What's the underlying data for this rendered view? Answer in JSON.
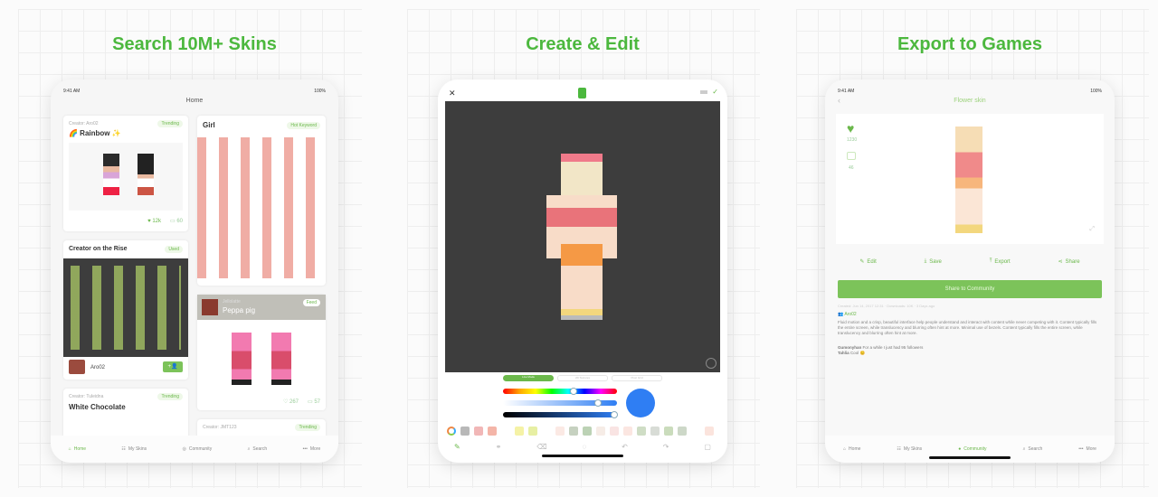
{
  "headlines": [
    "Search 10M+ Skins",
    "Create & Edit",
    "Export to Games"
  ],
  "colors": {
    "accent": "#6bb84b",
    "headline": "#4cb83e",
    "editor_bg": "#3d3d3d",
    "preview_blue": "#2f7ef3"
  },
  "panel1": {
    "status_time": "9:41 AM",
    "status_battery": "100%",
    "nav_title": "Home",
    "card_rainbow": {
      "creator": "Creator: Aro02",
      "badge": "Trending",
      "title": "🌈 Rainbow ✨",
      "likes": "12k",
      "comments": "60"
    },
    "card_girl": {
      "title": "Girl",
      "badge": "Hot Keyword"
    },
    "card_rise": {
      "title": "Creator on the Rise",
      "badge": "Used",
      "user": "Aro02",
      "follow_icon": "add-user-icon"
    },
    "card_peppa": {
      "creator": "Jellolatte",
      "badge": "Feed",
      "title": "Peppa pig",
      "likes": "267",
      "comments": "57"
    },
    "card_white": {
      "creator": "Creator: Tuleidna",
      "badge": "Trending",
      "title": "White Chocolate"
    },
    "card_jmt": {
      "creator": "Creator: JMT123",
      "badge": "Trending"
    },
    "tabs": [
      {
        "label": "Home",
        "icon": "home-icon",
        "active": true
      },
      {
        "label": "My Skins",
        "icon": "skins-icon"
      },
      {
        "label": "Community",
        "icon": "community-icon"
      },
      {
        "label": "Search",
        "icon": "search-icon"
      },
      {
        "label": "More",
        "icon": "more-icon"
      }
    ]
  },
  "panel2": {
    "close_icon": "✕",
    "confirm_icon": "✓",
    "mode_tabs": [
      "Live Mode",
      "2D Textures",
      "Pixel Grid"
    ],
    "hue_position": 0.62,
    "saturation_position": 0.83,
    "brightness_position": 0.98,
    "swatches": [
      "#b8b8b8",
      "#f1b7b7",
      "#f4b5a8",
      "#ffffff",
      "#f5f2a6",
      "#e7efa3",
      "#ffffff",
      "#fbe9e4",
      "#c6d1c0",
      "#bcd2b5",
      "#f6ece6",
      "#f9e4e3",
      "#fbe6e1",
      "#cfddc5",
      "#d8dcd6",
      "#cadcbc",
      "#cdd8c8",
      "#ffffff",
      "#fbe4dd"
    ],
    "tools": [
      "brush-icon",
      "link-icon",
      "eraser-icon",
      "bulb-icon",
      "undo-icon",
      "redo-icon",
      "crop-icon"
    ]
  },
  "panel3": {
    "status_time": "9:41 AM",
    "status_battery": "100%",
    "nav_title": "Flower skin",
    "likes": "1230",
    "comments": "46",
    "actions": [
      {
        "label": "Edit",
        "icon": "edit-icon"
      },
      {
        "label": "Save",
        "icon": "download-icon"
      },
      {
        "label": "Export",
        "icon": "export-icon"
      },
      {
        "label": "Share",
        "icon": "share-icon"
      }
    ],
    "share_button": "Share to Community",
    "meta": "Created: Jun 14, 2017 12:31 · Downloads: 10K · 3 Days ago",
    "author": "Aro02",
    "description": "Fluid motion and a crisp, beautiful interface help people understand and interact with content while never competing with it. Content typically fills the entire screen, while translucency and blurring often hint at more. Minimal use of bezels. Content typically fills the entire screen, while translucency and blurring often hint at more.",
    "comments_list": [
      {
        "user": "Gumonyhan",
        "text": "For a while I just had 95 followers"
      },
      {
        "user": "Tahlia",
        "text": "Cool 😊"
      }
    ],
    "tabs": [
      {
        "label": "Home",
        "icon": "home-icon"
      },
      {
        "label": "My Skins",
        "icon": "skins-icon"
      },
      {
        "label": "Community",
        "icon": "community-icon",
        "active": true
      },
      {
        "label": "Search",
        "icon": "search-icon"
      },
      {
        "label": "More",
        "icon": "more-icon"
      }
    ]
  }
}
